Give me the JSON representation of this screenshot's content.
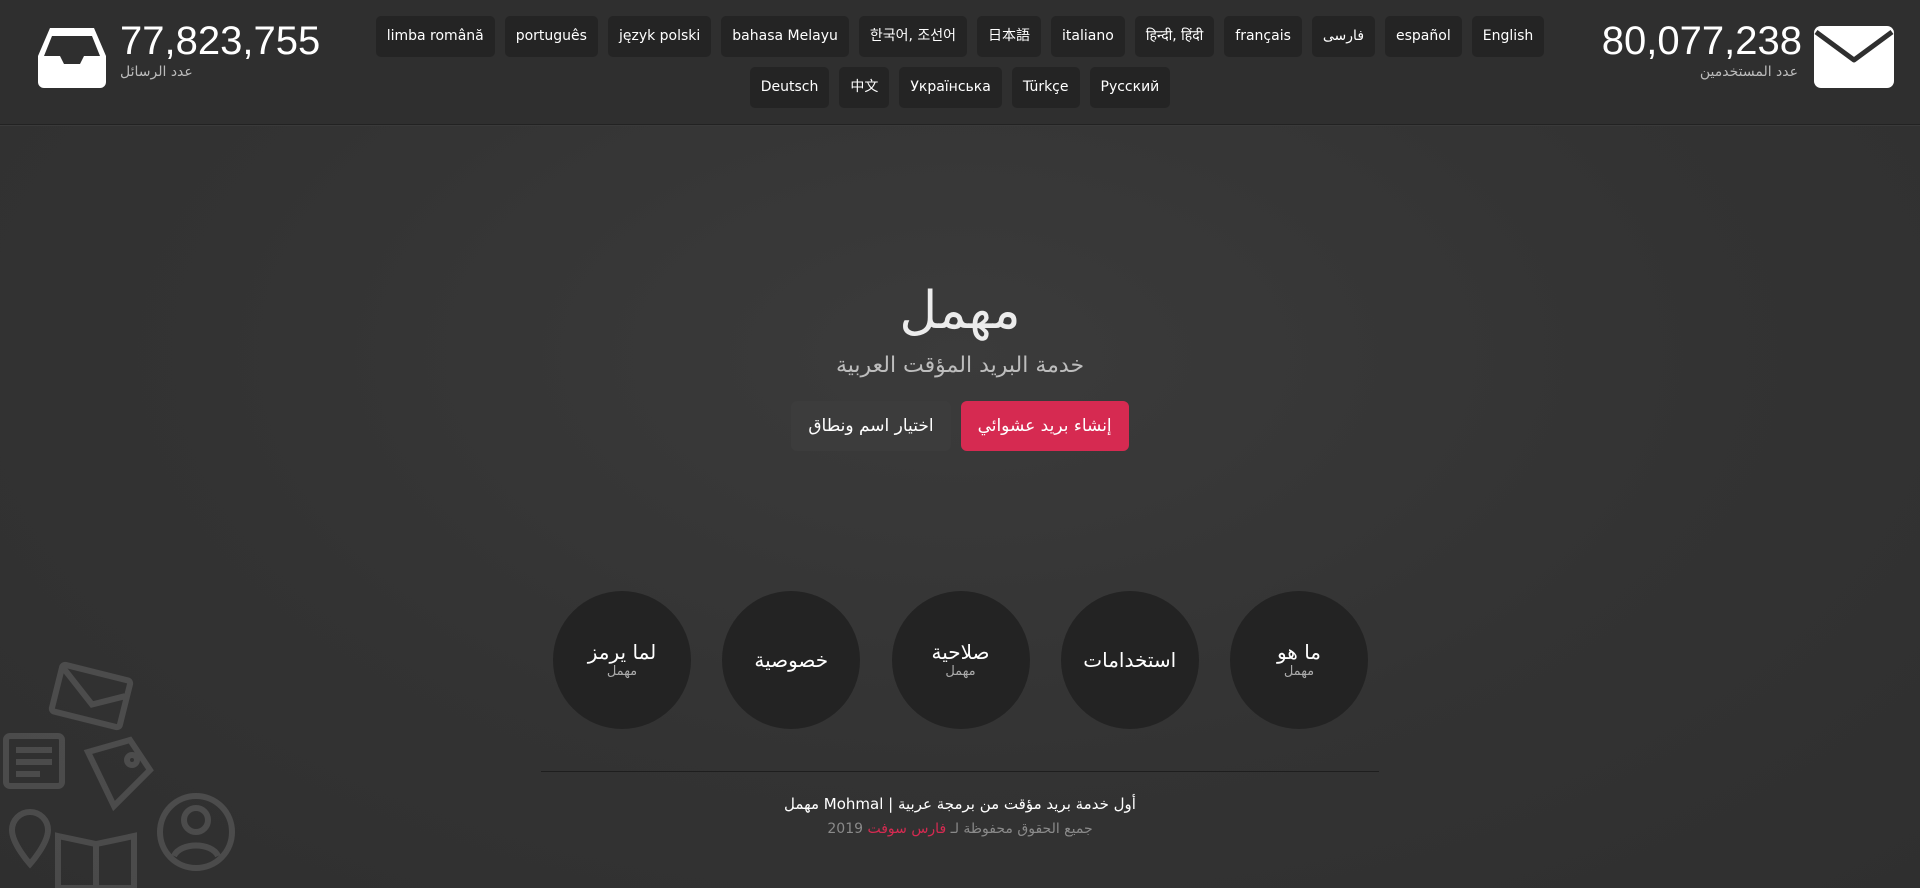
{
  "stats": {
    "messages": {
      "value": "77,823,755",
      "label": "عدد الرسائل",
      "icon": "inbox-tray-icon"
    },
    "users": {
      "value": "80,077,238",
      "label": "عدد المستخدمين",
      "icon": "envelope-icon"
    }
  },
  "languages": [
    "limba română",
    "português",
    "język polski",
    "bahasa Melayu",
    "한국어, 조선어",
    "日本語",
    "italiano",
    "हिन्दी, हिंदी",
    "français",
    "فارسی",
    "español",
    "English",
    "Deutsch",
    "中文",
    "Українська",
    "Türkçe",
    "Русский"
  ],
  "hero": {
    "logo_text": "مهمل",
    "tagline": "خدمة البريد المؤقت العربية",
    "random_button": "إنشاء بريد عشوائي",
    "choose_button": "اختيار اسم ونطاق"
  },
  "circles": [
    {
      "title": "ما هو",
      "sub": "مهمل"
    },
    {
      "title": "استخدامات",
      "sub": ""
    },
    {
      "title": "صلاحية",
      "sub": "مهمل"
    },
    {
      "title": "خصوصية",
      "sub": ""
    },
    {
      "title": "لما يرمز",
      "sub": "مهمل"
    }
  ],
  "footer": {
    "line1": "مهمل Mohmal | أول خدمة بريد مؤقت من برمجة عربية",
    "rights_prefix": "جميع الحقوق محفوظة لـ",
    "company": "فارس سوفت",
    "year": "2019"
  },
  "colors": {
    "accent": "#d62a51",
    "header_bg": "#2f2f2f",
    "button_dark": "#3c3c3c",
    "circle_bg": "#232323"
  }
}
